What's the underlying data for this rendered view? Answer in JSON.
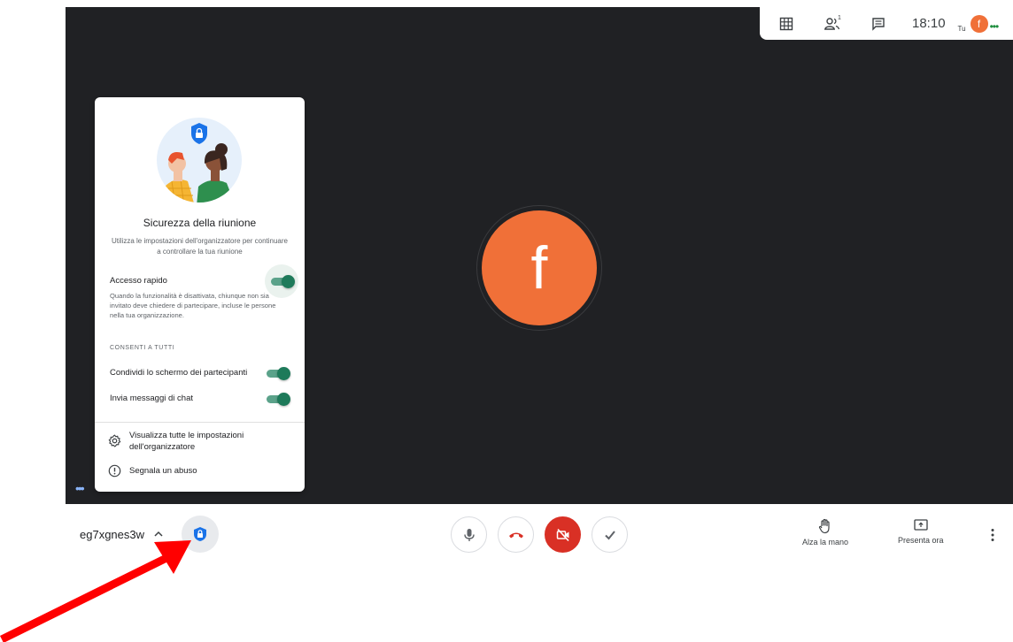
{
  "topbar": {
    "clock": "18:10",
    "self_label": "Tu",
    "self_avatar": "f",
    "participant_count": "1",
    "icons": [
      "grid-layout-icon",
      "people-icon",
      "chat-icon"
    ]
  },
  "stage": {
    "avatar_letter": "f"
  },
  "security_panel": {
    "title": "Sicurezza della riunione",
    "subtitle": "Utilizza le impostazioni dell'organizzatore per continuare a controllare la tua riunione",
    "quick_access": {
      "label": "Accesso rapido",
      "description": "Quando la funzionalità è disattivata, chiunque non sia invitato deve chiedere di partecipare, incluse le persone nella tua organizzazione.",
      "enabled": true
    },
    "section_label": "CONSENTI A TUTTI",
    "share_screen": {
      "label": "Condividi lo schermo dei partecipanti",
      "enabled": true
    },
    "chat": {
      "label": "Invia messaggi di chat",
      "enabled": true
    },
    "view_all_settings": "Visualizza tutte le impostazioni dell'organizzatore",
    "report_abuse": "Segnala un abuso"
  },
  "bottombar": {
    "meeting_code": "eg7xgnes3w",
    "raise_hand": "Alza la mano",
    "present_now": "Presenta ora"
  },
  "colors": {
    "stage_bg": "#202124",
    "avatar_orange": "#f07038",
    "toggle_on": "#1e7a5a",
    "end_call_red": "#d93025",
    "arrow_red": "#ff0000",
    "shield_blue": "#1a73e8"
  }
}
